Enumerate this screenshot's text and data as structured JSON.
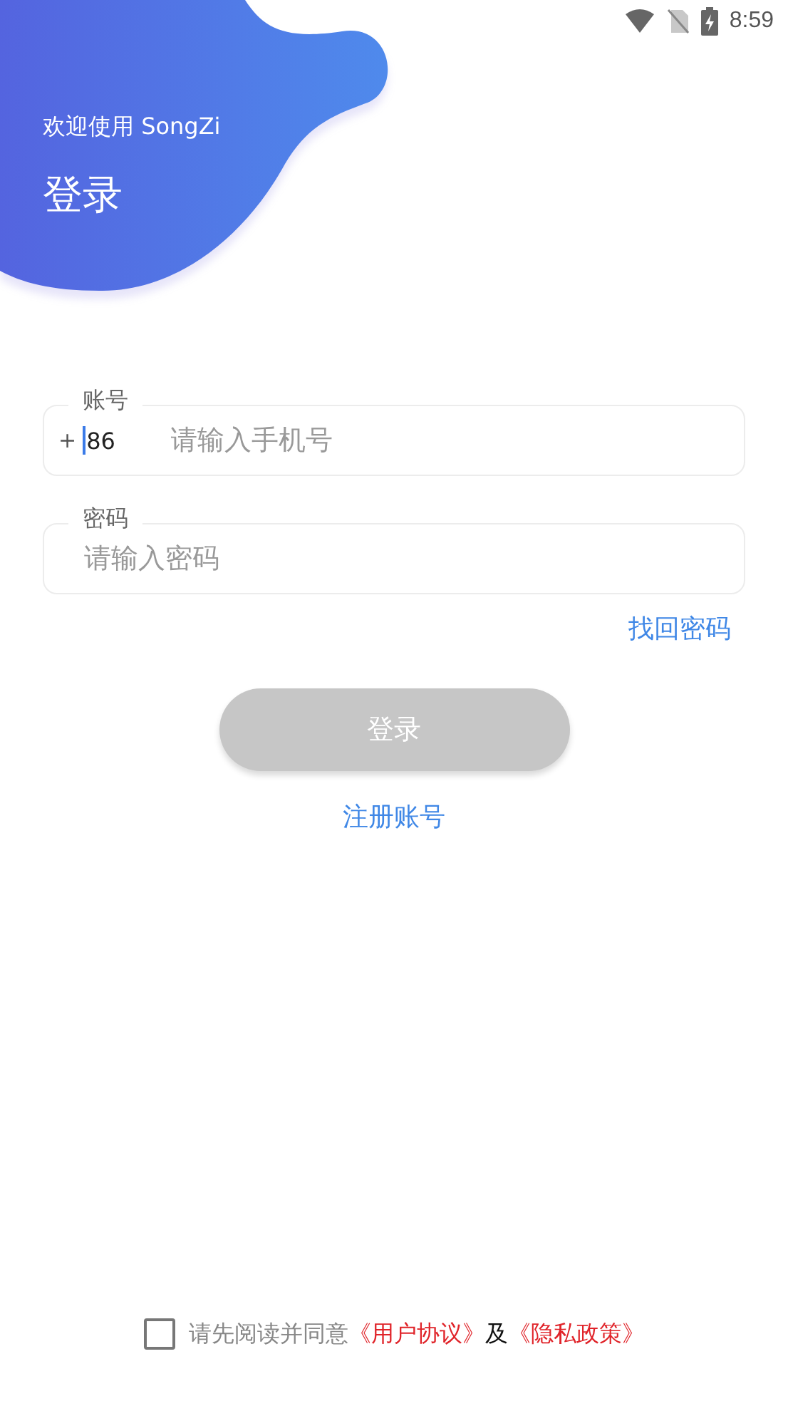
{
  "status_bar": {
    "time": "8:59"
  },
  "header": {
    "welcome": "欢迎使用 SongZi",
    "title": "登录"
  },
  "phone_field": {
    "label": "账号",
    "prefix": "+",
    "country_code": "86",
    "placeholder": "请输入手机号",
    "focused": true
  },
  "password_field": {
    "label": "密码",
    "placeholder": "请输入密码"
  },
  "forgot_link": "找回密码",
  "login_button": {
    "label": "登录",
    "disabled": true
  },
  "register_link": "注册账号",
  "agreement": {
    "checked": false,
    "text": "请先阅读并同意",
    "conjunction": "及",
    "links": [
      "《用户协议》",
      "《隐私政策》"
    ]
  }
}
